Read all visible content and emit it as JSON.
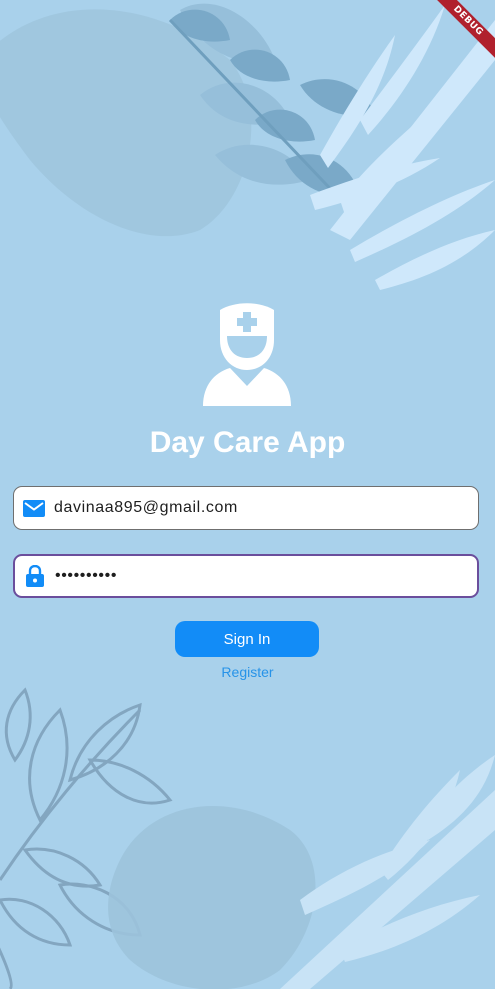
{
  "app": {
    "title": "Day Care App",
    "debug_label": "DEBUG"
  },
  "form": {
    "email": {
      "value": "davinaa895@gmail.com",
      "icon": "mail-icon"
    },
    "password": {
      "value": "••••••••••",
      "icon": "lock-icon"
    }
  },
  "actions": {
    "signin_label": "Sign In",
    "register_label": "Register"
  },
  "colors": {
    "background": "#a9d1eb",
    "accent": "#128cf7",
    "focus_border": "#6b4e9c"
  }
}
